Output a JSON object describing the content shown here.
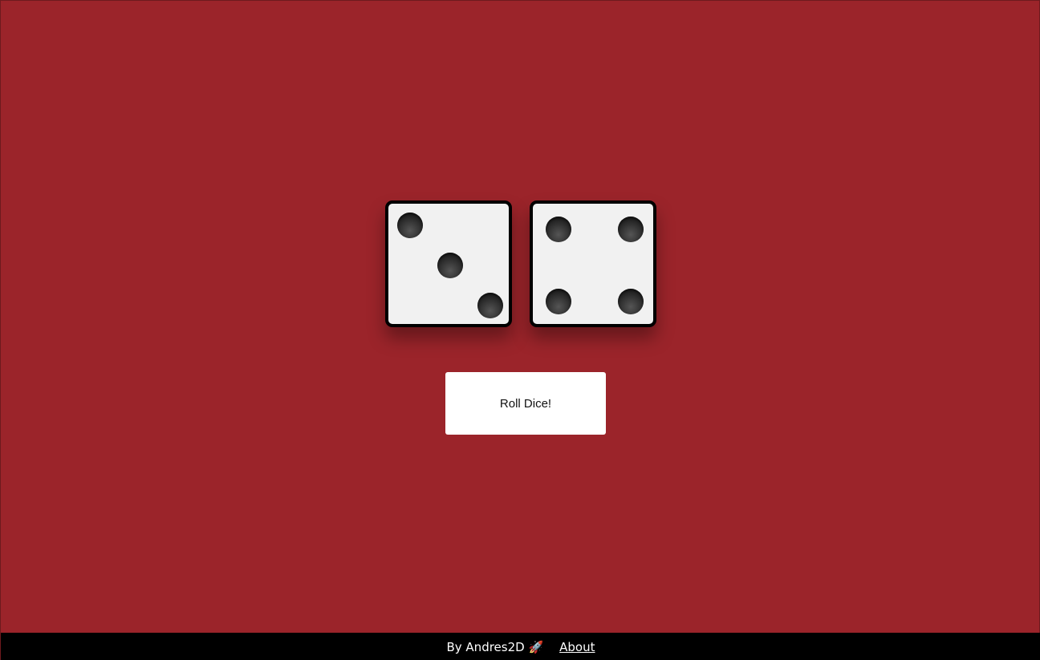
{
  "dice": {
    "values": [
      3,
      4
    ],
    "face_color": "#f1f1f1",
    "pip_color": "#2b2b2b"
  },
  "roll_button": {
    "label": "Roll Dice!"
  },
  "footer": {
    "credit": "By Andres2D 🚀",
    "about_link": "About"
  },
  "colors": {
    "background": "#9b242a",
    "footer_background": "#000000"
  }
}
